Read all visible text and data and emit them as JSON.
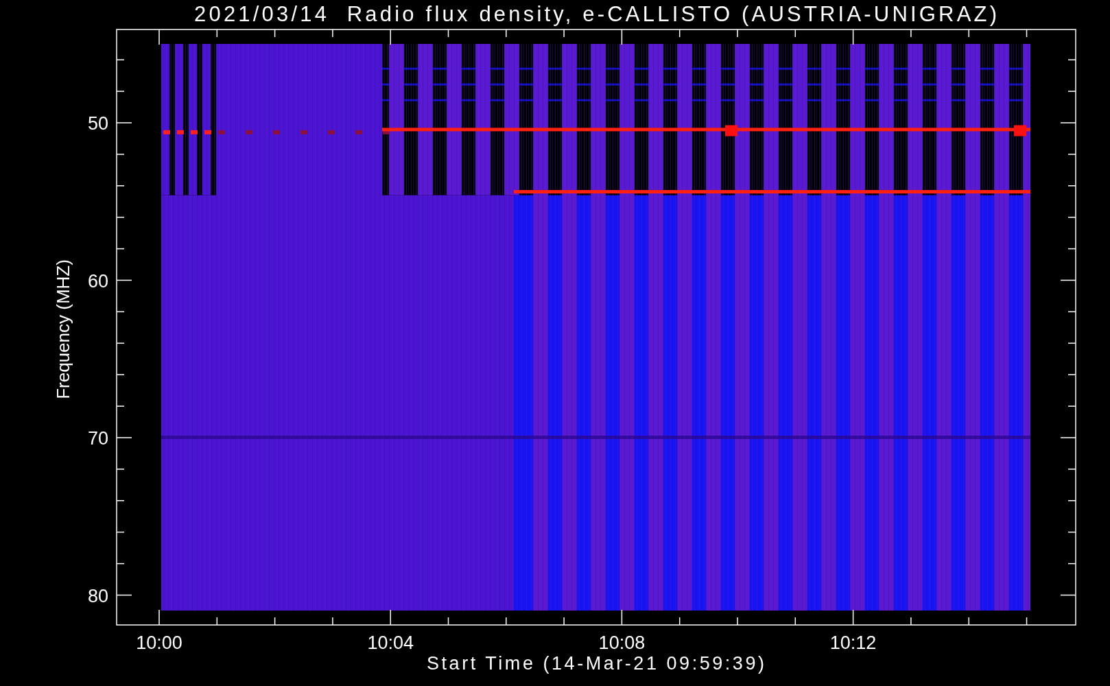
{
  "title": "2021/03/14  Radio flux density, e-CALLISTO (AUSTRIA-UNIGRAZ)",
  "y_axis": {
    "label": "Frequency (MHZ)",
    "ticks": [
      "50",
      "60",
      "70",
      "80"
    ]
  },
  "x_axis": {
    "label": "Start Time (14-Mar-21 09:59:39)",
    "ticks": [
      "10:00",
      "10:04",
      "10:08",
      "10:12"
    ]
  }
}
